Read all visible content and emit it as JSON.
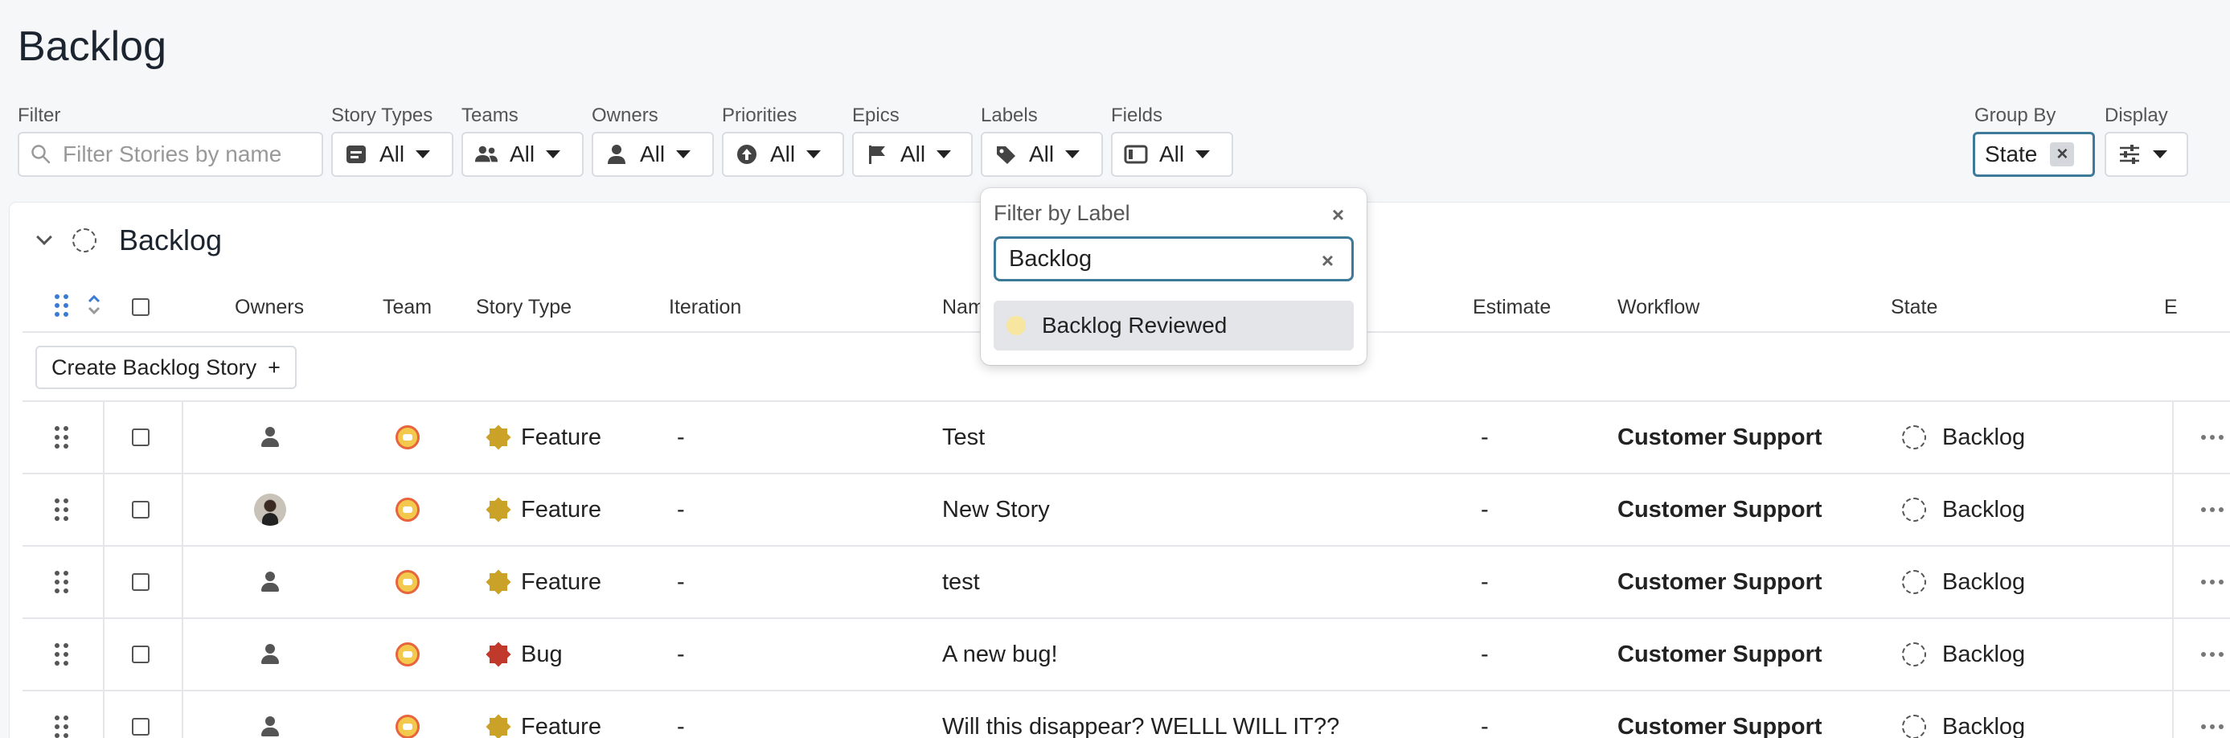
{
  "page": {
    "title": "Backlog"
  },
  "filters": {
    "filter_label": "Filter",
    "search_placeholder": "Filter Stories by name",
    "story_types": {
      "label": "Story Types",
      "value": "All"
    },
    "teams": {
      "label": "Teams",
      "value": "All"
    },
    "owners": {
      "label": "Owners",
      "value": "All"
    },
    "priorities": {
      "label": "Priorities",
      "value": "All"
    },
    "epics": {
      "label": "Epics",
      "value": "All"
    },
    "labels": {
      "label": "Labels",
      "value": "All"
    },
    "fields": {
      "label": "Fields",
      "value": "All"
    },
    "group_by": {
      "label": "Group By",
      "value": "State",
      "clear": "×"
    },
    "display": {
      "label": "Display"
    }
  },
  "section": {
    "title": "Backlog"
  },
  "table": {
    "columns": {
      "owners": "Owners",
      "team": "Team",
      "story_type": "Story Type",
      "iteration": "Iteration",
      "name": "Nam",
      "estimate": "Estimate",
      "workflow": "Workflow",
      "state": "State",
      "extra": "E"
    },
    "create_label": "Create Backlog Story",
    "create_plus": "+",
    "rows": [
      {
        "owner": "person-icon",
        "type": "Feature",
        "type_color": "#c9a227",
        "iteration": "-",
        "name": "Test",
        "estimate": "-",
        "workflow": "Customer Support",
        "state": "Backlog"
      },
      {
        "owner": "avatar",
        "type": "Feature",
        "type_color": "#c9a227",
        "iteration": "-",
        "name": "New Story",
        "estimate": "-",
        "workflow": "Customer Support",
        "state": "Backlog"
      },
      {
        "owner": "person-icon",
        "type": "Feature",
        "type_color": "#c9a227",
        "iteration": "-",
        "name": "test",
        "estimate": "-",
        "workflow": "Customer Support",
        "state": "Backlog"
      },
      {
        "owner": "person-icon",
        "type": "Bug",
        "type_color": "#c0392b",
        "iteration": "-",
        "name": "A new bug!",
        "estimate": "-",
        "workflow": "Customer Support",
        "state": "Backlog"
      },
      {
        "owner": "person-icon",
        "type": "Feature",
        "type_color": "#c9a227",
        "iteration": "-",
        "name": "Will this disappear? WELLL WILL IT??",
        "estimate": "-",
        "workflow": "Customer Support",
        "state": "Backlog"
      }
    ]
  },
  "label_filter": {
    "title": "Filter by Label",
    "close": "×",
    "query": "Backlog",
    "clear": "×",
    "option": "Backlog Reviewed",
    "option_color": "#f6e6a0"
  }
}
